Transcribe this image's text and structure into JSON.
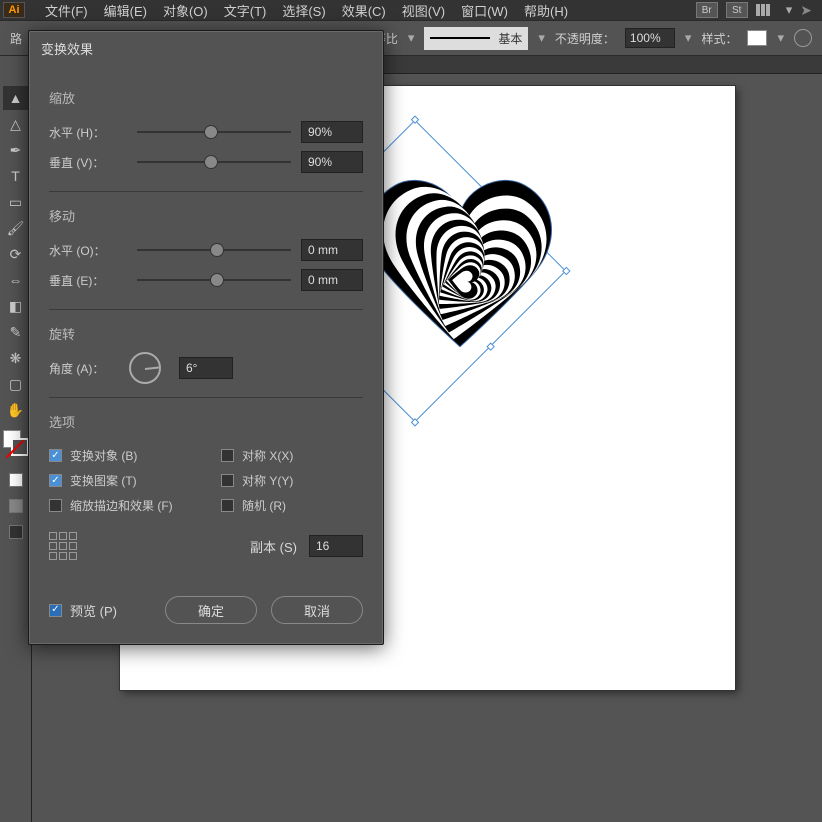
{
  "app": {
    "logo": "Ai"
  },
  "menu": {
    "file": "文件(F)",
    "edit": "编辑(E)",
    "object": "对象(O)",
    "text": "文字(T)",
    "select": "选择(S)",
    "effect": "效果(C)",
    "view": "视图(V)",
    "window": "窗口(W)",
    "help": "帮助(H)",
    "br": "Br",
    "st": "St"
  },
  "controlbar": {
    "path_label": "路",
    "uniform_label": "等比",
    "stroke_style_label": "基本",
    "opacity_label": "不透明度：",
    "opacity_value": "100%",
    "style_label": "样式："
  },
  "dialog": {
    "title": "变换效果",
    "scale": {
      "section": "缩放",
      "h_label": "水平 (H)：",
      "h_value": "90%",
      "v_label": "垂直 (V)：",
      "v_value": "90%"
    },
    "move": {
      "section": "移动",
      "h_label": "水平 (O)：",
      "h_value": "0 mm",
      "v_label": "垂直 (E)：",
      "v_value": "0 mm"
    },
    "rotate": {
      "section": "旋转",
      "angle_label": "角度 (A)：",
      "angle_value": "6°"
    },
    "options": {
      "section": "选项",
      "transform_objects": "变换对象 (B)",
      "transform_patterns": "变换图案 (T)",
      "scale_strokes": "缩放描边和效果 (F)",
      "reflect_x": "对称 X(X)",
      "reflect_y": "对称 Y(Y)",
      "random": "随机 (R)"
    },
    "copies_label": "副本 (S)",
    "copies_value": "16",
    "preview_label": "预览 (P)",
    "ok": "确定",
    "cancel": "取消"
  }
}
